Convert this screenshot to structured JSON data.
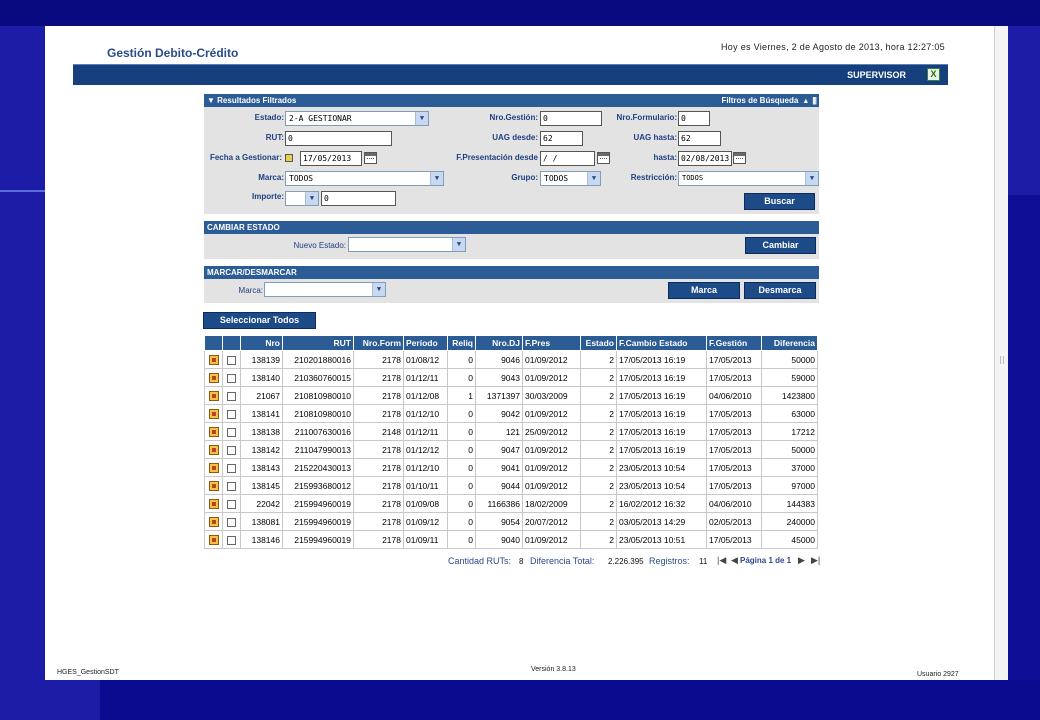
{
  "app": {
    "title": "Gestión Debito-Crédito",
    "datetime": "Hoy es Viernes, 2 de Agosto de 2013, hora 12:27:05",
    "role": "SUPERVISOR"
  },
  "filters": {
    "header": "Resultados Filtrados",
    "toggle_label": "Filtros de Búsqueda",
    "estado_label": "Estado:",
    "estado_value": "2-A GESTIONAR",
    "nro_gestion_label": "Nro.Gestión:",
    "nro_gestion_value": "0",
    "nro_formulario_label": "Nro.Formulario:",
    "nro_formulario_value": "0",
    "rut_label": "RUT:",
    "rut_value": "0",
    "uag_desde_label": "UAG desde:",
    "uag_desde_value": "62",
    "uag_hasta_label": "UAG hasta:",
    "uag_hasta_value": "62",
    "fecha_gestionar_label": "Fecha a Gestionar:",
    "fecha_gestionar_value": "17/05/2013",
    "f_presentacion_label": "F.Presentación desde",
    "f_presentacion_value": " / /",
    "hasta_label": "hasta:",
    "hasta_value": "02/08/2013",
    "marca_label": "Marca:",
    "marca_value": "TODOS",
    "grupo_label": "Grupo:",
    "grupo_value": "TODOS",
    "restriccion_label": "Restricción:",
    "restriccion_value": "TODOS",
    "importe_label": "Importe:",
    "importe_op": "",
    "importe_value": "0",
    "buscar_label": "Buscar"
  },
  "cambiar_estado": {
    "header": "CAMBIAR ESTADO",
    "nuevo_estado_label": "Nuevo Estado:",
    "nuevo_estado_value": "",
    "cambiar_label": "Cambiar"
  },
  "marcar": {
    "header": "MARCAR/DESMARCAR",
    "marca_label": "Marca:",
    "marca_value": "",
    "marca_btn": "Marca",
    "desmarca_btn": "Desmarca"
  },
  "select_all_label": "Seleccionar Todos",
  "table": {
    "headers": [
      "Nro",
      "RUT",
      "Nro.Form",
      "Período",
      "Reliq",
      "Nro.DJ",
      "F.Pres",
      "Estado",
      "F.Cambio Estado",
      "F.Gestión",
      "Diferencia"
    ],
    "rows": [
      [
        "138139",
        "210201880016",
        "2178",
        "01/08/12",
        "0",
        "9046",
        "01/09/2012",
        "2",
        "17/05/2013 16:19",
        "17/05/2013",
        "50000"
      ],
      [
        "138140",
        "210360760015",
        "2178",
        "01/12/11",
        "0",
        "9043",
        "01/09/2012",
        "2",
        "17/05/2013 16:19",
        "17/05/2013",
        "59000"
      ],
      [
        "21067",
        "210810980010",
        "2178",
        "01/12/08",
        "1",
        "1371397",
        "30/03/2009",
        "2",
        "17/05/2013 16:19",
        "04/06/2010",
        "1423800"
      ],
      [
        "138141",
        "210810980010",
        "2178",
        "01/12/10",
        "0",
        "9042",
        "01/09/2012",
        "2",
        "17/05/2013 16:19",
        "17/05/2013",
        "63000"
      ],
      [
        "138138",
        "211007630016",
        "2148",
        "01/12/11",
        "0",
        "121",
        "25/09/2012",
        "2",
        "17/05/2013 16:19",
        "17/05/2013",
        "17212"
      ],
      [
        "138142",
        "211047990013",
        "2178",
        "01/12/12",
        "0",
        "9047",
        "01/09/2012",
        "2",
        "17/05/2013 16:19",
        "17/05/2013",
        "50000"
      ],
      [
        "138143",
        "215220430013",
        "2178",
        "01/12/10",
        "0",
        "9041",
        "01/09/2012",
        "2",
        "23/05/2013 10:54",
        "17/05/2013",
        "37000"
      ],
      [
        "138145",
        "215993680012",
        "2178",
        "01/10/11",
        "0",
        "9044",
        "01/09/2012",
        "2",
        "23/05/2013 10:54",
        "17/05/2013",
        "97000"
      ],
      [
        "22042",
        "215994960019",
        "2178",
        "01/09/08",
        "0",
        "1166386",
        "18/02/2009",
        "2",
        "16/02/2012 16:32",
        "04/06/2010",
        "144383"
      ],
      [
        "138081",
        "215994960019",
        "2178",
        "01/09/12",
        "0",
        "9054",
        "20/07/2012",
        "2",
        "03/05/2013 14:29",
        "02/05/2013",
        "240000"
      ],
      [
        "138146",
        "215994960019",
        "2178",
        "01/09/11",
        "0",
        "9040",
        "01/09/2012",
        "2",
        "23/05/2013 10:51",
        "17/05/2013",
        "45000"
      ]
    ]
  },
  "summary": {
    "cantidad_label": "Cantidad RUTs:",
    "cantidad_value": "8",
    "diferencia_label": "Diferencia Total:",
    "diferencia_value": "2.226.395",
    "registros_label": "Registros:",
    "registros_value": "11",
    "pagina_label": "Página 1 de 1"
  },
  "footer": {
    "left": "HGES_GestionSDT",
    "center": "Versión 3.8.13",
    "right": "Usuario 2927"
  }
}
